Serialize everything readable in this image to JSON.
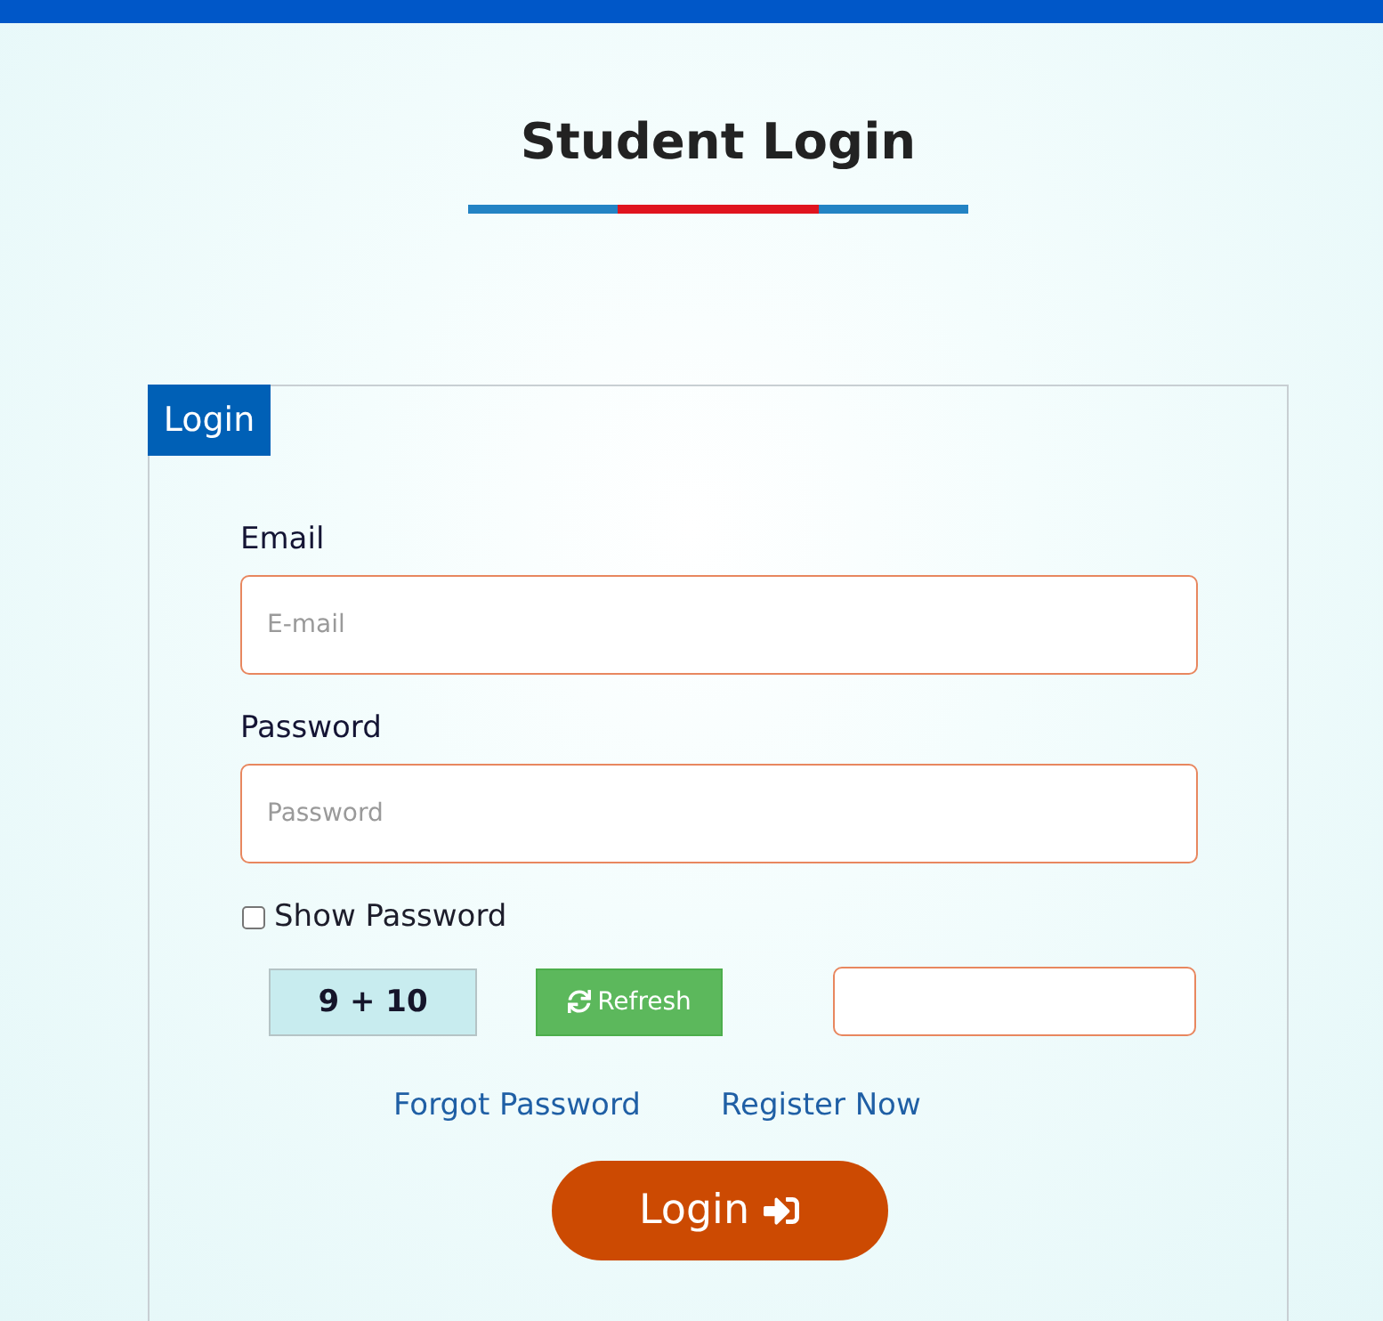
{
  "title": "Student Login",
  "login_form": {
    "legend": "Login",
    "fields": [
      {
        "label": "Email",
        "placeholder": "E-mail"
      },
      {
        "label": "Password",
        "placeholder": "Password"
      }
    ],
    "show_password": {
      "label": "Show Password",
      "checked": false
    },
    "captcha": {
      "question": "9 + 10",
      "refresh_label": "Refresh"
    },
    "links": [
      "Forgot Password",
      "Register Now"
    ],
    "submit_label": "Login"
  }
}
